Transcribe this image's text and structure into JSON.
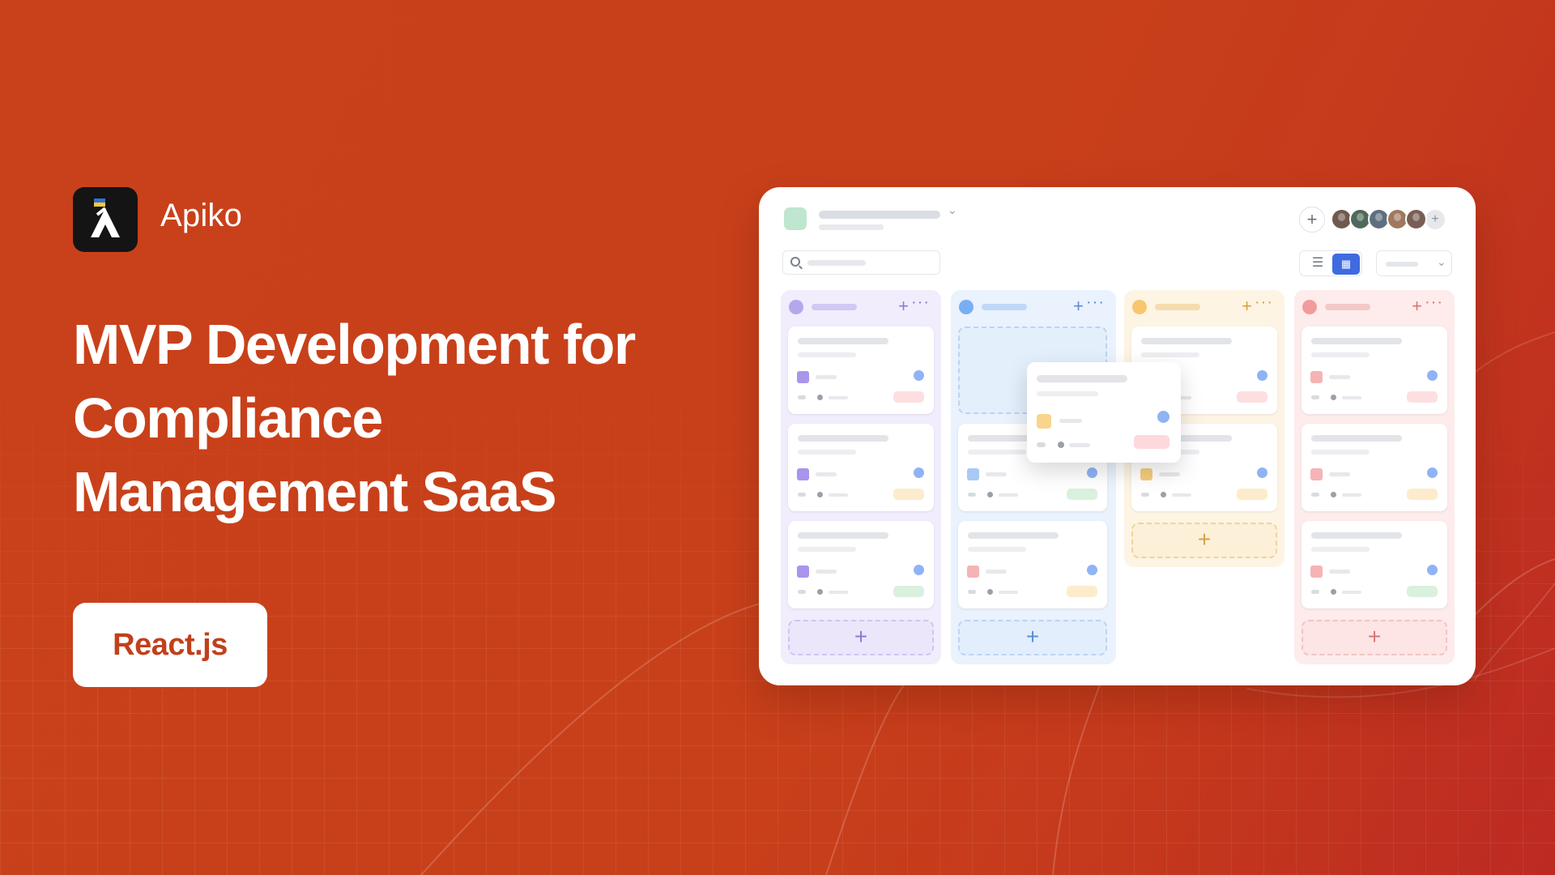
{
  "brand": {
    "name": "Apiko"
  },
  "headline": {
    "lines": [
      "MVP Development for",
      "Compliance",
      "Management SaaS"
    ]
  },
  "tech": {
    "label": "React.js"
  },
  "board": {
    "add_symbol": "+",
    "more_symbol": "···",
    "chevron": "⌄",
    "list_view_icon": "☰",
    "grid_view_icon": "▦",
    "columns": [
      {
        "color": "#b7a6ee",
        "bg": "#f1edfc",
        "accent": "#8b7ad8",
        "square": "#a995ec",
        "pills": [
          "#fddfe1",
          "#fdeccc",
          "#d9f1de"
        ]
      },
      {
        "color": "#79aef2",
        "bg": "#e9f2fd",
        "accent": "#5a8fd8",
        "square": "#a9c9f5",
        "pills": [
          "#d9f1de",
          "#fdeccc"
        ]
      },
      {
        "color": "#f7c66f",
        "bg": "#fdf4e4",
        "accent": "#d9a243",
        "square": "#f5cd7f",
        "pills": [
          "#fddfe1",
          "#fdeccc"
        ]
      },
      {
        "color": "#f29b9b",
        "bg": "#fdeceb",
        "accent": "#d97474",
        "square": "#f6b3b5",
        "pills": [
          "#fddfe1",
          "#fdeccc",
          "#d9f1de"
        ]
      }
    ],
    "avatar_colors": [
      "#6f5a4e",
      "#4f6a5a",
      "#5e6f7f",
      "#a07860",
      "#7a5e54"
    ]
  },
  "colors": {
    "background": "#c9411a",
    "accent_text": "#c2401b"
  }
}
